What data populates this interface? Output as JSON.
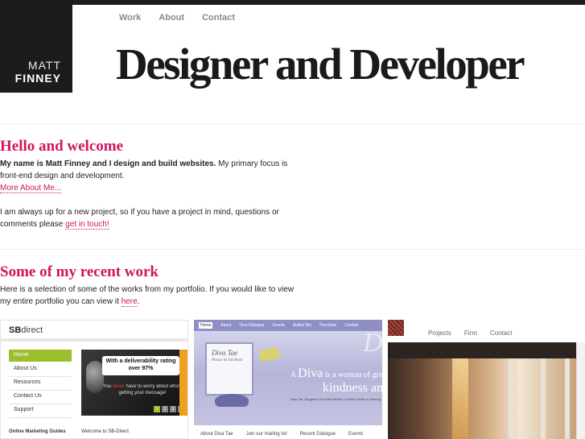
{
  "logo": {
    "line1": "MATT",
    "line2": "FINNEY"
  },
  "nav": {
    "items": [
      "Work",
      "About",
      "Contact"
    ]
  },
  "headline": "Designer and Developer",
  "welcome": {
    "heading": "Hello and welcome",
    "intro_bold": "My name is Matt Finney and I design and build websites.",
    "intro_rest": " My primary focus is front-end design and development.",
    "more_link": "More About Me...",
    "project_text": "I am always up for a new project, so if you have a project in mind, questions or comments please ",
    "contact_link": "get in touch!"
  },
  "recent": {
    "heading": "Some of my recent work",
    "text": "Here is a selection of some of the works from my portfolio. If you would like to view my entire portfolio you can view it ",
    "portfolio_link": "here",
    "period": "."
  },
  "thumb1": {
    "brand_prefix": "SB",
    "brand_rest": "direct",
    "menu": [
      "Home",
      "About Us",
      "Resources",
      "Contact Us",
      "Support"
    ],
    "bubble": "With a deliverability rating over 97%",
    "sub_pre": "You ",
    "sub_red": "never",
    "sub_post": " have to worry about who's getting your message!",
    "pages": [
      "1",
      "2",
      "3",
      "4"
    ],
    "footer_left": "Online Marketing Guides",
    "footer_right": "Welcome to SB-Direct"
  },
  "thumb2": {
    "tabs": [
      "Home",
      "About",
      "Diva Dialogue",
      "Events",
      "Author Bio",
      "Purchase",
      "Contact"
    ],
    "card_title": "Diva Tae",
    "card_sub": "Please let the Book",
    "quote_a": "A ",
    "quote_diva": "Diva",
    "quote_rest": " is a woman of gre",
    "quote_line2": "kindness and",
    "tiny": "Diva Tae | Bugadoo The New Album | A Drivel Guide to Sharing",
    "footer": [
      "About Diva Tae",
      "Join our mailing list",
      "Recent Dialogue",
      "Events"
    ]
  },
  "thumb3": {
    "nav": [
      "Projects",
      "Firm",
      "Contact"
    ]
  },
  "colors": {
    "accent": "#d0145f",
    "dark": "#1c1c1c",
    "nav_gray": "#8a8a8a"
  }
}
